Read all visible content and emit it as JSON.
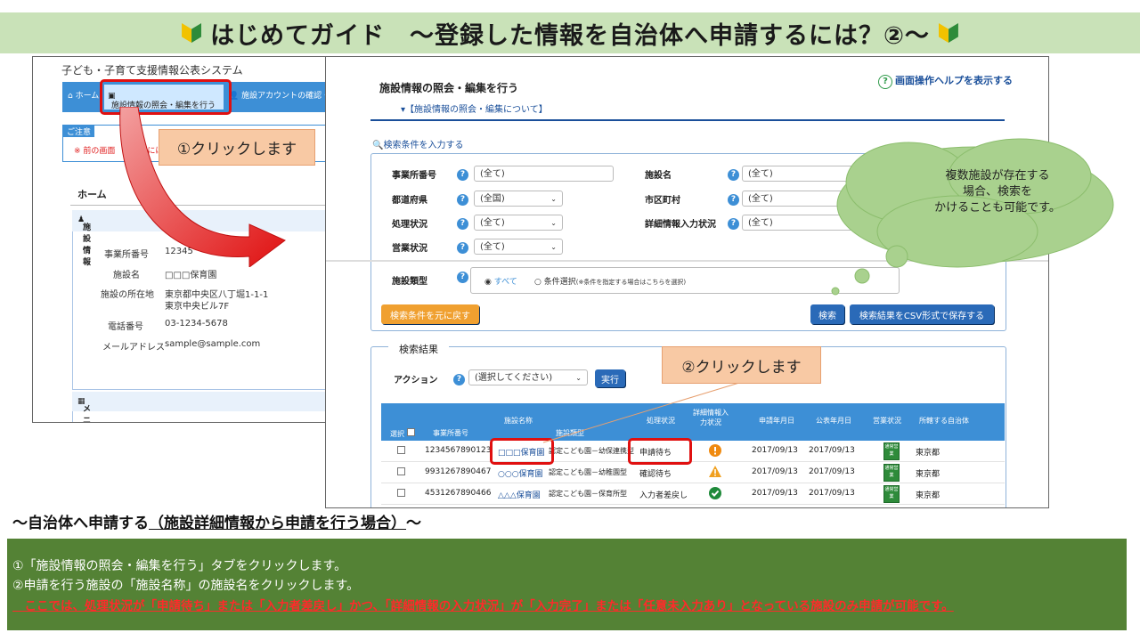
{
  "banner": {
    "title": "はじめてガイド　～登録した情報を自治体へ申請するには？②～"
  },
  "left_screen": {
    "system_title": "子ども・子育て支援情報公表システム",
    "tabs": [
      "ホーム",
      "施設情報の照会・編集を行う",
      "施設アカウントの確認・編"
    ],
    "notice_header": "ご注意",
    "notice_text": "※ 前の画面　　　　には上",
    "home_heading": "ホーム",
    "facility_section": "施設情報",
    "facility_fields": [
      {
        "label": "事業所番号",
        "value": "12345"
      },
      {
        "label": "施設名",
        "value": "□□□保育園"
      },
      {
        "label": "施設の所在地",
        "value": "東京都中央区八丁堀1-1-1"
      },
      {
        "label": "",
        "value": "東京中央ビル7F"
      },
      {
        "label": "電話番号",
        "value": "03-1234-5678"
      },
      {
        "label": "メールアドレス",
        "value": "sample@sample.com"
      }
    ],
    "menu_section": "メニュー説明"
  },
  "callout1": "①クリックします",
  "callout2": "②クリックします",
  "cloud_text": "複数施設が存在する\n場合、検索を\nかけることも可能です。",
  "right_screen": {
    "title": "施設情報の照会・編集を行う",
    "sub_link": "▾【施設情報の照会・編集について】",
    "help_link": "画面操作ヘルプを表示する",
    "help_icon": "?",
    "search_link": "検索条件を入力する",
    "fields": {
      "office_no": {
        "label": "事業所番号",
        "value": "(全て)"
      },
      "facility_name": {
        "label": "施設名",
        "value": "(全て)"
      },
      "prefecture": {
        "label": "都道府県",
        "value": "(全国)"
      },
      "city": {
        "label": "市区町村",
        "value": "(全て)"
      },
      "process_status": {
        "label": "処理状況",
        "value": "(全て)"
      },
      "detail_status": {
        "label": "詳細情報入力状況",
        "value": "(全て)"
      },
      "business_status": {
        "label": "営業状況",
        "value": "(全て)"
      }
    },
    "facility_type_label": "施設類型",
    "radio_all": "すべて",
    "radio_select": "条件選択",
    "radio_note": "(※条件を指定する場合はこちらを選択)",
    "reset_button": "検索条件を元に戻す",
    "search_button": "検索",
    "csv_button": "検索結果をCSV形式で保存する",
    "results_title": "検索結果",
    "action_label": "アクション",
    "action_value": "(選択してください)",
    "run_button": "実行",
    "columns": [
      "選択",
      "事業所番号",
      "施設名称",
      "施設類型",
      "処理状況",
      "詳細情報入力状況",
      "申請年月日",
      "公表年月日",
      "営業状況",
      "所轄する自治体"
    ],
    "rows": [
      {
        "office_no": "1234567890123",
        "name": "□□□保育園",
        "type": "認定こども園－幼保連携型",
        "status": "申請待ち",
        "detail": "warning-orange",
        "applied": "2017/09/13",
        "published": "2017/09/13",
        "biz": "通常営業",
        "authority": "東京都"
      },
      {
        "office_no": "9931267890467",
        "name": "○○○保育園",
        "type": "認定こども園－幼稚園型",
        "status": "確認待ち",
        "detail": "caution-triangle",
        "applied": "2017/09/13",
        "published": "2017/09/13",
        "biz": "通常営業",
        "authority": "東京都"
      },
      {
        "office_no": "4531267890466",
        "name": "△△△保育園",
        "type": "認定こども園－保育所型",
        "status": "入力者差戻し",
        "detail": "check-green",
        "applied": "2017/09/13",
        "published": "2017/09/13",
        "biz": "通常営業",
        "authority": "東京都"
      }
    ]
  },
  "caption": {
    "prefix": "～自治体へ申請する",
    "underlined": "（施設詳細情報から申請を行う場合）",
    "suffix": "～"
  },
  "instructions": [
    "①「施設情報の照会・編集を行う」タブをクリックします。",
    "②申請を行う施設の「施設名称」の施設名をクリックします。",
    "　ここでは、処理状況が「申請待ち」または「入力者差戻し」かつ、「詳細情報の入力状況」が「入力完了」または「任意未入力あり」となっている施設のみ申請が可能です。"
  ],
  "colors": {
    "banner_bg": "#c9e2b8",
    "info_bg": "#548235",
    "accent_blue": "#3d8fd6",
    "highlight_red": "#e01010",
    "callout_bg": "#f8c9a4"
  }
}
